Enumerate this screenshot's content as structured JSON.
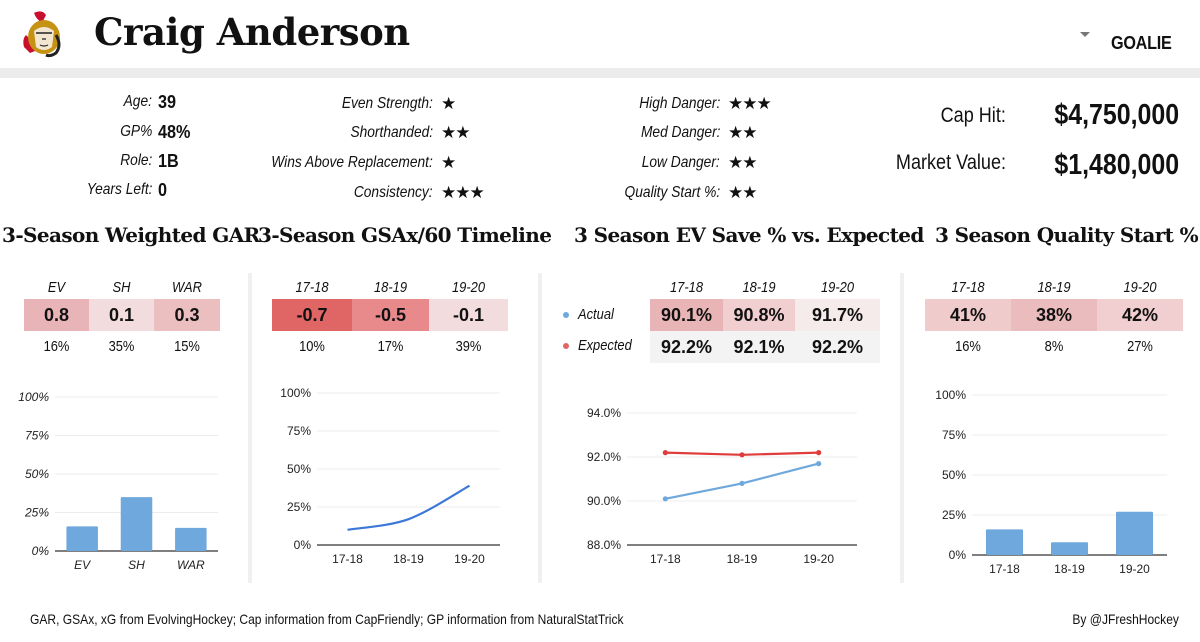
{
  "header": {
    "team_logo": "ottawa-senators-logo",
    "player_name": "Craig Anderson",
    "position": "GOALIE",
    "dropdown_icon": "caret-down-icon"
  },
  "bio": [
    {
      "label": "Age:",
      "value": "39"
    },
    {
      "label": "GP%",
      "value": "48%"
    },
    {
      "label": "Role:",
      "value": "1B"
    },
    {
      "label": "Years Left:",
      "value": "0"
    }
  ],
  "ratings_left": [
    {
      "label": "Even Strength:",
      "stars": "★",
      "count": 1
    },
    {
      "label": "Shorthanded:",
      "stars": "★★",
      "count": 2
    },
    {
      "label": "Wins Above Replacement:",
      "stars": "★",
      "count": 1
    },
    {
      "label": "Consistency:",
      "stars": "★★★",
      "count": 3
    }
  ],
  "ratings_right": [
    {
      "label": "High Danger:",
      "stars": "★★★",
      "count": 3
    },
    {
      "label": "Med Danger:",
      "stars": "★★",
      "count": 2
    },
    {
      "label": "Low Danger:",
      "stars": "★★",
      "count": 2
    },
    {
      "label": "Quality Start %:",
      "stars": "★★",
      "count": 2
    }
  ],
  "contract": {
    "cap_hit_label": "Cap Hit:",
    "cap_hit": "$4,750,000",
    "market_value_label": "Market Value:",
    "market_value": "$1,480,000"
  },
  "sections": {
    "gar": {
      "title": "3-Season Weighted GAR",
      "columns": [
        "EV",
        "SH",
        "WAR"
      ],
      "values": [
        "0.8",
        "0.1",
        "0.3"
      ],
      "percentiles": [
        "16%",
        "35%",
        "15%"
      ],
      "cell_colors": [
        "#e8b4b7",
        "#f3dcdd",
        "#ebbec0"
      ]
    },
    "gsax": {
      "title": "3-Season GSAx/60 Timeline",
      "columns": [
        "17-18",
        "18-19",
        "19-20"
      ],
      "values": [
        "-0.7",
        "-0.5",
        "-0.1"
      ],
      "percentiles": [
        "10%",
        "17%",
        "39%"
      ],
      "cell_colors": [
        "#e06666",
        "#e88a8c",
        "#f3dcdd"
      ]
    },
    "ev_save": {
      "title": "3 Season EV Save % vs. Expected",
      "columns": [
        "17-18",
        "18-19",
        "19-20"
      ],
      "rows": [
        {
          "label": "Actual",
          "color": "#6fa8dc",
          "values": [
            "90.1%",
            "90.8%",
            "91.7%"
          ],
          "cell_colors": [
            "#e9b4b6",
            "#f1cfd0",
            "#f6ebeb"
          ]
        },
        {
          "label": "Expected",
          "color": "#e06666",
          "values": [
            "92.2%",
            "92.1%",
            "92.2%"
          ],
          "cell_colors": [
            "#f3f3f3",
            "#f3f3f3",
            "#f3f3f3"
          ]
        }
      ]
    },
    "quality_start": {
      "title": "3 Season Quality Start %",
      "columns": [
        "17-18",
        "18-19",
        "19-20"
      ],
      "values": [
        "41%",
        "38%",
        "42%"
      ],
      "percentiles": [
        "16%",
        "8%",
        "27%"
      ],
      "cell_colors": [
        "#f0cbcc",
        "#ebbcbe",
        "#f1cecf"
      ]
    }
  },
  "chart_data": [
    {
      "type": "bar",
      "title": "3-Season Weighted GAR percentiles",
      "categories": [
        "EV",
        "SH",
        "WAR"
      ],
      "values": [
        16,
        35,
        15
      ],
      "yticks": [
        "0%",
        "25%",
        "50%",
        "75%",
        "100%"
      ],
      "ylim": [
        0,
        100
      ],
      "grid": true,
      "color": "#6fa8dc"
    },
    {
      "type": "line",
      "title": "3-Season GSAx/60 percentile timeline",
      "categories": [
        "17-18",
        "18-19",
        "19-20"
      ],
      "values": [
        10,
        17,
        39
      ],
      "yticks": [
        "0%",
        "25%",
        "50%",
        "75%",
        "100%"
      ],
      "ylim": [
        0,
        100
      ],
      "grid": true,
      "color": "#3c78d8"
    },
    {
      "type": "line",
      "title": "3 Season EV Save % vs. Expected",
      "categories": [
        "17-18",
        "18-19",
        "19-20"
      ],
      "series": [
        {
          "name": "Actual",
          "values": [
            90.1,
            90.8,
            91.7
          ],
          "color": "#6fa8dc"
        },
        {
          "name": "Expected",
          "values": [
            92.2,
            92.1,
            92.2
          ],
          "color": "#e03c3c"
        }
      ],
      "yticks": [
        "88.0%",
        "90.0%",
        "92.0%",
        "94.0%"
      ],
      "ylim": [
        88,
        94
      ],
      "grid": true
    },
    {
      "type": "bar",
      "title": "3 Season Quality Start % percentiles",
      "categories": [
        "17-18",
        "18-19",
        "19-20"
      ],
      "values": [
        16,
        8,
        27
      ],
      "yticks": [
        "0%",
        "25%",
        "50%",
        "75%",
        "100%"
      ],
      "ylim": [
        0,
        100
      ],
      "grid": true,
      "color": "#6fa8dc"
    }
  ],
  "footer": {
    "sources": "GAR, GSAx, xG from EvolvingHockey; Cap information from CapFriendly; GP information from NaturalStatTrick",
    "credit": "By @JFreshHockey"
  }
}
